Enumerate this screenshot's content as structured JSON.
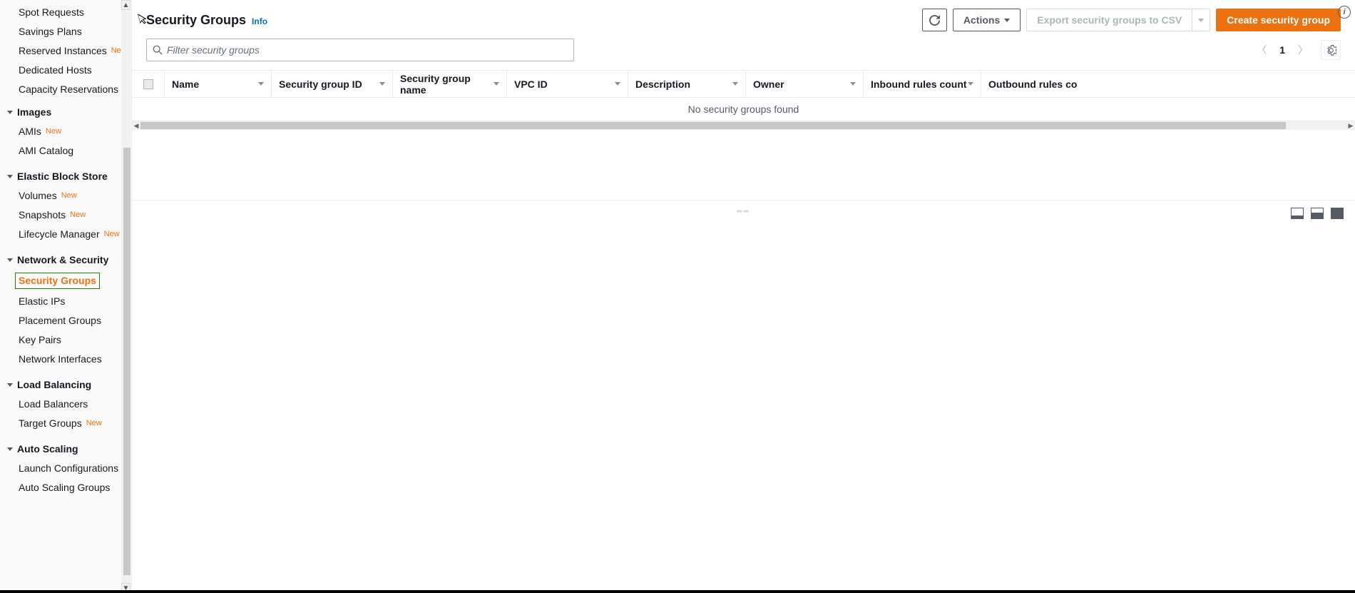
{
  "sidebar": {
    "top_items": [
      {
        "label": "Spot Requests",
        "new": false
      },
      {
        "label": "Savings Plans",
        "new": false
      },
      {
        "label": "Reserved Instances",
        "new": true
      },
      {
        "label": "Dedicated Hosts",
        "new": false
      },
      {
        "label": "Capacity Reservations",
        "new": false
      }
    ],
    "sections": [
      {
        "title": "Images",
        "items": [
          {
            "label": "AMIs",
            "new": true
          },
          {
            "label": "AMI Catalog",
            "new": false
          }
        ]
      },
      {
        "title": "Elastic Block Store",
        "items": [
          {
            "label": "Volumes",
            "new": true
          },
          {
            "label": "Snapshots",
            "new": true
          },
          {
            "label": "Lifecycle Manager",
            "new": true
          }
        ]
      },
      {
        "title": "Network & Security",
        "items": [
          {
            "label": "Security Groups",
            "new": false,
            "active": true
          },
          {
            "label": "Elastic IPs",
            "new": false
          },
          {
            "label": "Placement Groups",
            "new": false
          },
          {
            "label": "Key Pairs",
            "new": false
          },
          {
            "label": "Network Interfaces",
            "new": false
          }
        ]
      },
      {
        "title": "Load Balancing",
        "items": [
          {
            "label": "Load Balancers",
            "new": false
          },
          {
            "label": "Target Groups",
            "new": true
          }
        ]
      },
      {
        "title": "Auto Scaling",
        "items": [
          {
            "label": "Launch Configurations",
            "new": false
          },
          {
            "label": "Auto Scaling Groups",
            "new": false
          }
        ]
      }
    ],
    "new_badge_text": "New"
  },
  "header": {
    "title": "Security Groups",
    "info_label": "Info",
    "actions_label": "Actions",
    "export_label": "Export security groups to CSV",
    "create_label": "Create security group"
  },
  "filter": {
    "placeholder": "Filter security groups"
  },
  "pager": {
    "page": "1"
  },
  "table": {
    "columns": {
      "name": "Name",
      "sgid": "Security group ID",
      "sgname": "Security group name",
      "vpc": "VPC ID",
      "desc": "Description",
      "owner": "Owner",
      "inbound": "Inbound rules count",
      "outbound": "Outbound rules co"
    },
    "empty_message": "No security groups found"
  }
}
